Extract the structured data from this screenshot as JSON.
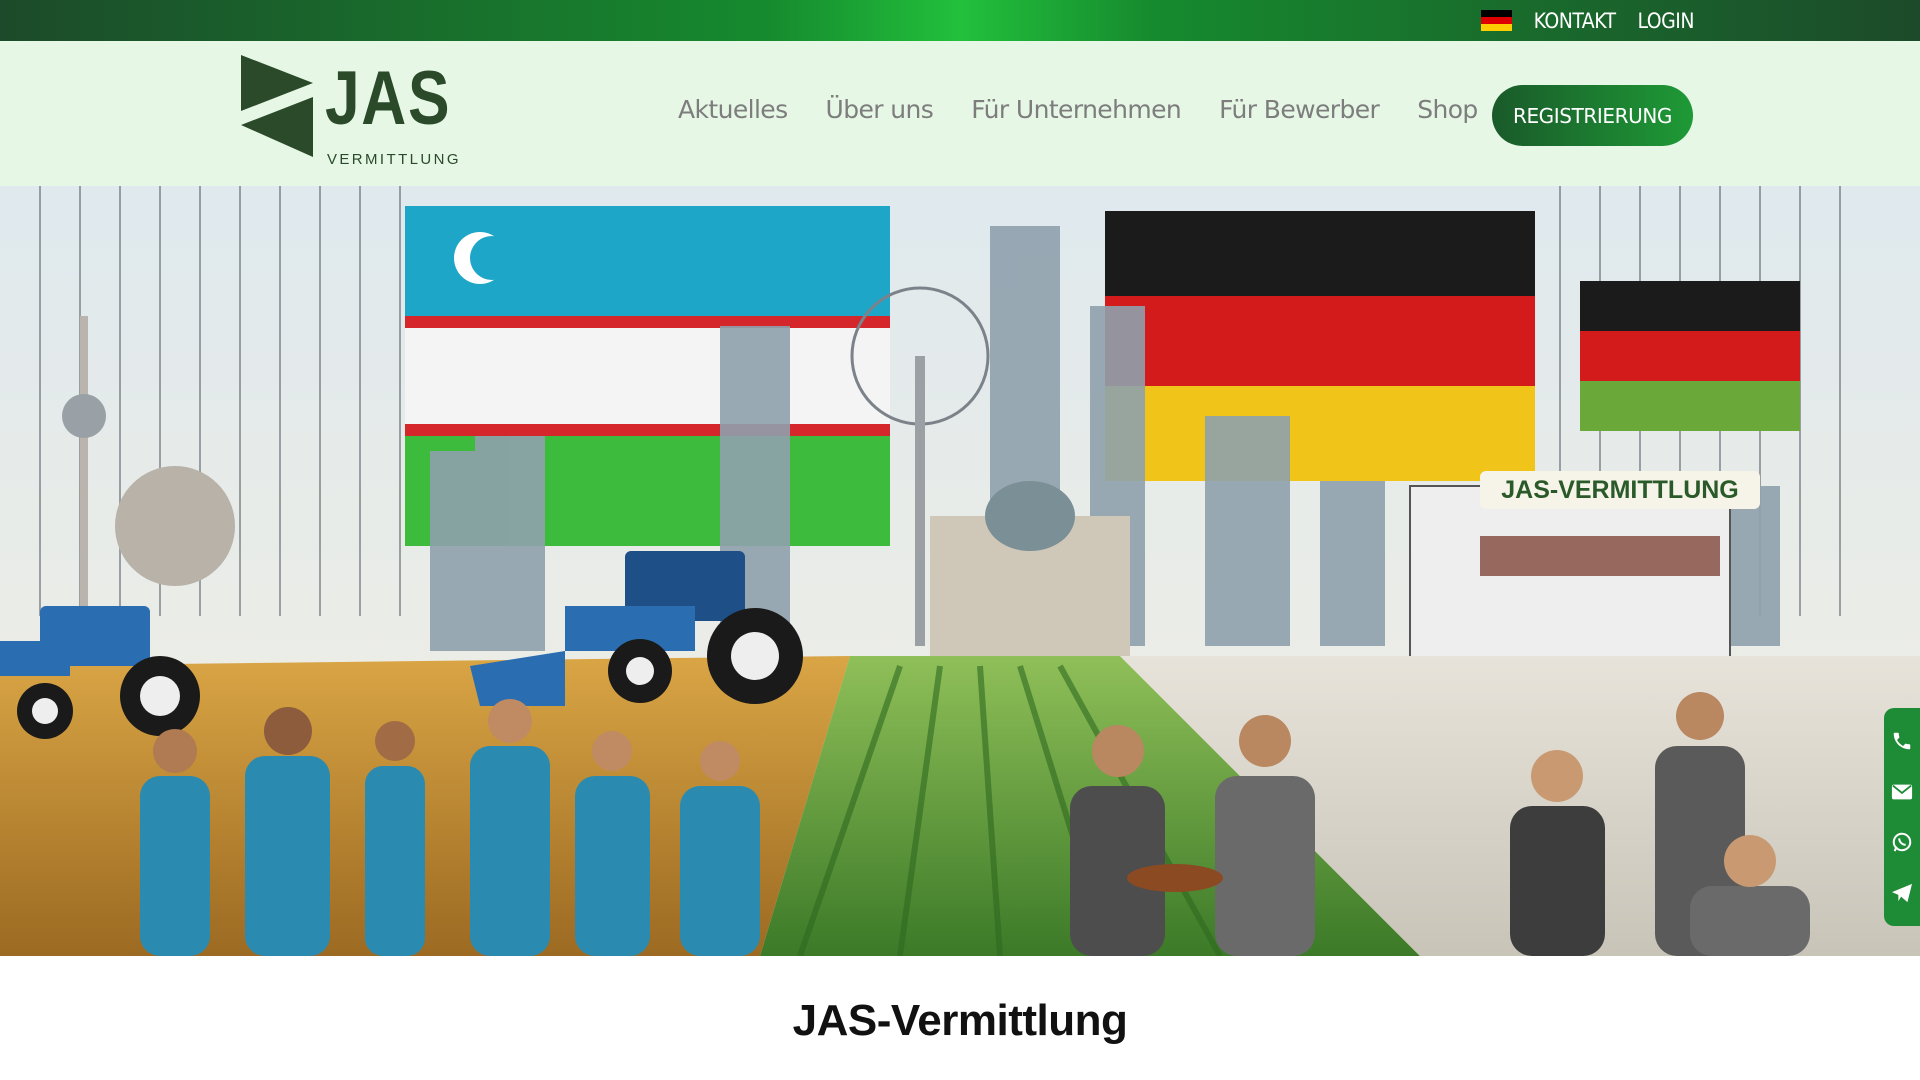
{
  "topbar": {
    "language_flag": "de-flag-icon",
    "contact_label": "KONTAKT",
    "login_label": "LOGIN"
  },
  "header": {
    "logo_text": "JAS",
    "logo_subtext": "VERMITTLUNG",
    "nav": [
      {
        "label": "Aktuelles"
      },
      {
        "label": "Über uns"
      },
      {
        "label": "Für Unternehmen"
      },
      {
        "label": "Für Bewerber"
      },
      {
        "label": "Shop"
      }
    ],
    "register_label": "REGISTRIERUNG"
  },
  "hero": {
    "image_sign_text": "JAS-VERMITTLUNG"
  },
  "side_social": {
    "icons": [
      "phone-icon",
      "mail-icon",
      "whatsapp-icon",
      "telegram-icon"
    ]
  },
  "main": {
    "title": "JAS-Vermittlung"
  },
  "colors": {
    "brand_green": "#1e8c36",
    "brand_dark": "#2b4a2a",
    "header_bg": "#e6f7e6",
    "nav_text": "#7d7d7d"
  }
}
